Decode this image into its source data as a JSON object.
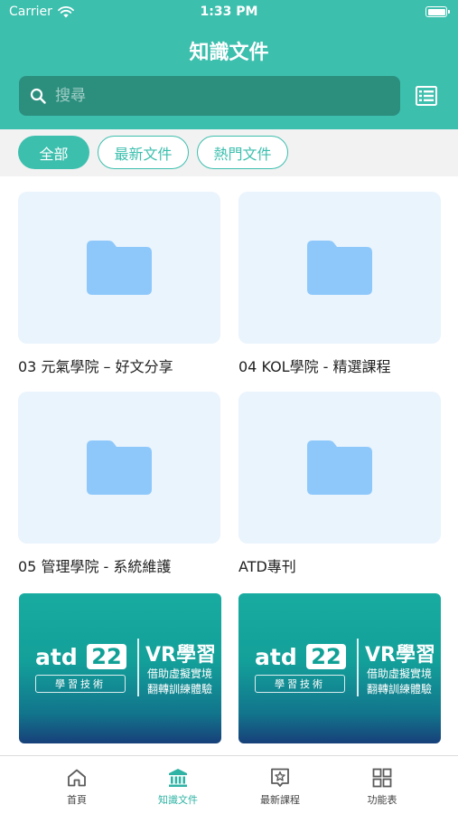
{
  "status_bar": {
    "carrier": "Carrier",
    "time": "1:33 PM"
  },
  "header": {
    "title": "知識文件"
  },
  "search": {
    "placeholder": "搜尋"
  },
  "filters": [
    {
      "label": "全部",
      "active": true
    },
    {
      "label": "最新文件",
      "active": false
    },
    {
      "label": "熱門文件",
      "active": false
    }
  ],
  "folders": [
    {
      "label": "03 元氣學院 – 好文分享"
    },
    {
      "label": "04 KOL學院 - 精選課程"
    },
    {
      "label": "05 管理學院 - 系統維護"
    },
    {
      "label": "ATD專刊"
    }
  ],
  "banners": [
    {
      "brand": "atd",
      "number": "22",
      "subtitle": "學習技術",
      "title": "VR學習",
      "line1": "借助虛擬實境",
      "line2": "翻轉訓練體驗"
    },
    {
      "brand": "atd",
      "number": "22",
      "subtitle": "學習技術",
      "title": "VR學習",
      "line1": "借助虛擬實境",
      "line2": "翻轉訓練體驗"
    }
  ],
  "bottom_nav": [
    {
      "label": "首頁",
      "icon": "home-icon",
      "active": false
    },
    {
      "label": "知識文件",
      "icon": "library-icon",
      "active": true
    },
    {
      "label": "最新課程",
      "icon": "star-board-icon",
      "active": false
    },
    {
      "label": "功能表",
      "icon": "grid-icon",
      "active": false
    }
  ],
  "colors": {
    "primary": "#3dbfae",
    "search_bg": "#2c8f7e",
    "folder": "#8ec8fb",
    "card_bg": "#eaf4fd"
  }
}
